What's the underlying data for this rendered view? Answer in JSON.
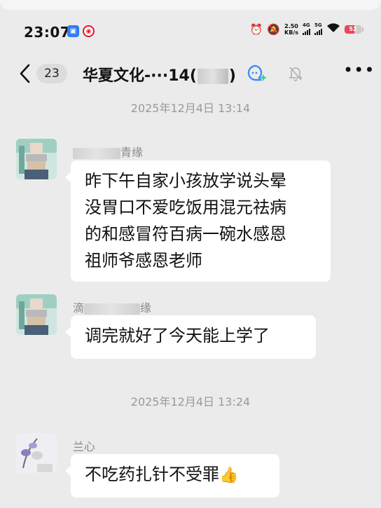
{
  "status_bar": {
    "time": "23:07",
    "net_speed_value": "2.50",
    "net_speed_unit": "KB/s",
    "sig1_label": "4G",
    "sig2_label": "5G",
    "battery_level": "52"
  },
  "header": {
    "back_icon": "chevron-left-icon",
    "unread_count": "23",
    "title_prefix": "华夏文化-···14(",
    "title_suffix": ")"
  },
  "timestamps": [
    "2025年12月4日 13:14",
    "2025年12月4日 13:24"
  ],
  "messages": [
    {
      "sender_visible": "青缘",
      "text_lines": [
        "昨下午自家小孩放学说头晕",
        "没胃口不爱吃饭用混元祛病",
        "的和感冒符百病一碗水感恩",
        "祖师爷感恩老师"
      ]
    },
    {
      "sender_prefix": "滴",
      "sender_suffix": "缘",
      "text": "调完就好了今天能上学了"
    },
    {
      "sender": "兰心",
      "text": "不吃药扎针不受罪",
      "emoji": "👍"
    }
  ]
}
